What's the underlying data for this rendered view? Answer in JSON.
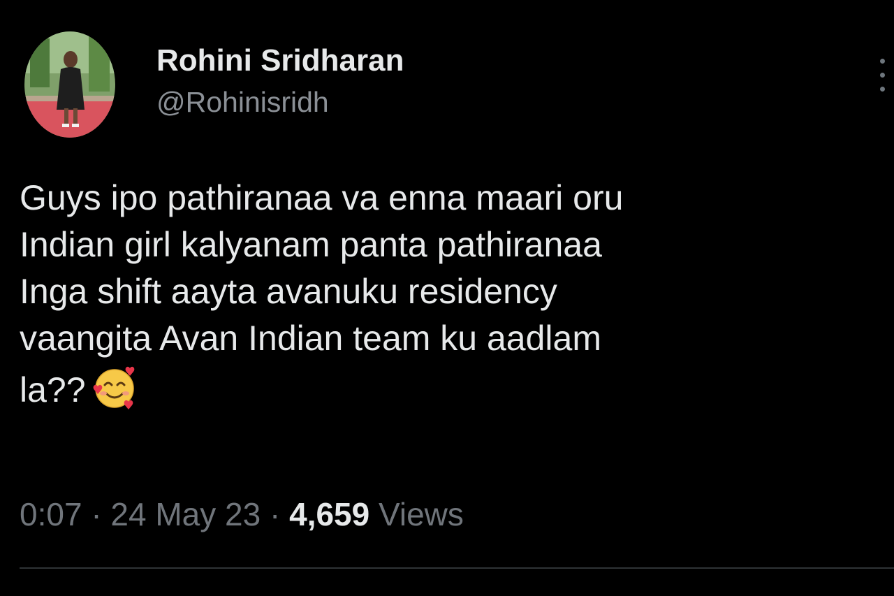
{
  "author": {
    "display_name": "Rohini Sridharan",
    "handle": "@Rohinisridh",
    "avatar_icon": "profile-photo"
  },
  "more_icon": "ellipsis-vertical-icon",
  "tweet": {
    "lines": [
      "Guys ipo pathiranaa va enna maari oru",
      "Indian girl kalyanam panta pathiranaa",
      "Inga shift aayta avanuku residency",
      "vaangita Avan Indian team ku aadlam",
      "la??"
    ],
    "emoji": "🥰",
    "emoji_icon": "smiling-face-with-hearts-icon"
  },
  "meta": {
    "time": "0:07",
    "separator": "·",
    "date": "24 May 23",
    "views_count": "4,659",
    "views_label": "Views"
  },
  "colors": {
    "background": "#000000",
    "primary_text": "#e7e9ea",
    "secondary_text": "#70757b",
    "divider": "#2f3336"
  }
}
